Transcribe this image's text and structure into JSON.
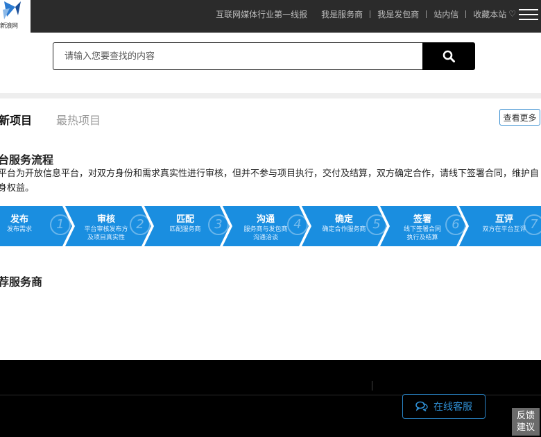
{
  "header": {
    "logo_text": "新浪网",
    "nav": [
      {
        "label": "互联网媒体行业第一线报"
      },
      {
        "label": "我是服务商"
      },
      {
        "label": "我是发包商"
      },
      {
        "label": "站内信"
      },
      {
        "label": "收藏本站"
      }
    ]
  },
  "search": {
    "placeholder": "请输入您要查找的内容",
    "value": ""
  },
  "tabs": {
    "active": "新项目",
    "inactive": "最热项目",
    "more": "查看更多"
  },
  "flow": {
    "title": "台服务流程",
    "description": "平台为开放信息平台，对双方身份和需求真实性进行审核，但并不参与项目执行，交付及结算，双方确定合作，请线下签署合同，维护自身权益。",
    "steps": [
      {
        "title": "发布",
        "sub1": "发布需求",
        "sub2": "",
        "num": "1"
      },
      {
        "title": "审核",
        "sub1": "平台审核发布方",
        "sub2": "及项目真实性",
        "num": "2"
      },
      {
        "title": "匹配",
        "sub1": "匹配服务商",
        "sub2": "",
        "num": "3"
      },
      {
        "title": "沟通",
        "sub1": "服务商与发包商",
        "sub2": "沟通洽谈",
        "num": "4"
      },
      {
        "title": "确定",
        "sub1": "确定合作服务商",
        "sub2": "",
        "num": "5"
      },
      {
        "title": "签署",
        "sub1": "线下签署合同",
        "sub2": "执行及结算",
        "num": "6"
      },
      {
        "title": "互评",
        "sub1": "双方在平台互评",
        "sub2": "",
        "num": "7"
      }
    ],
    "color": "#1a8ee0"
  },
  "recommend": {
    "title": "荐服务商"
  },
  "footer": {
    "customer_service": "在线客服",
    "feedback_line1": "反馈",
    "feedback_line2": "建议"
  },
  "colors": {
    "topbar": "#2b2b2b",
    "accent": "#1a8ee0",
    "footer": "#000000"
  }
}
